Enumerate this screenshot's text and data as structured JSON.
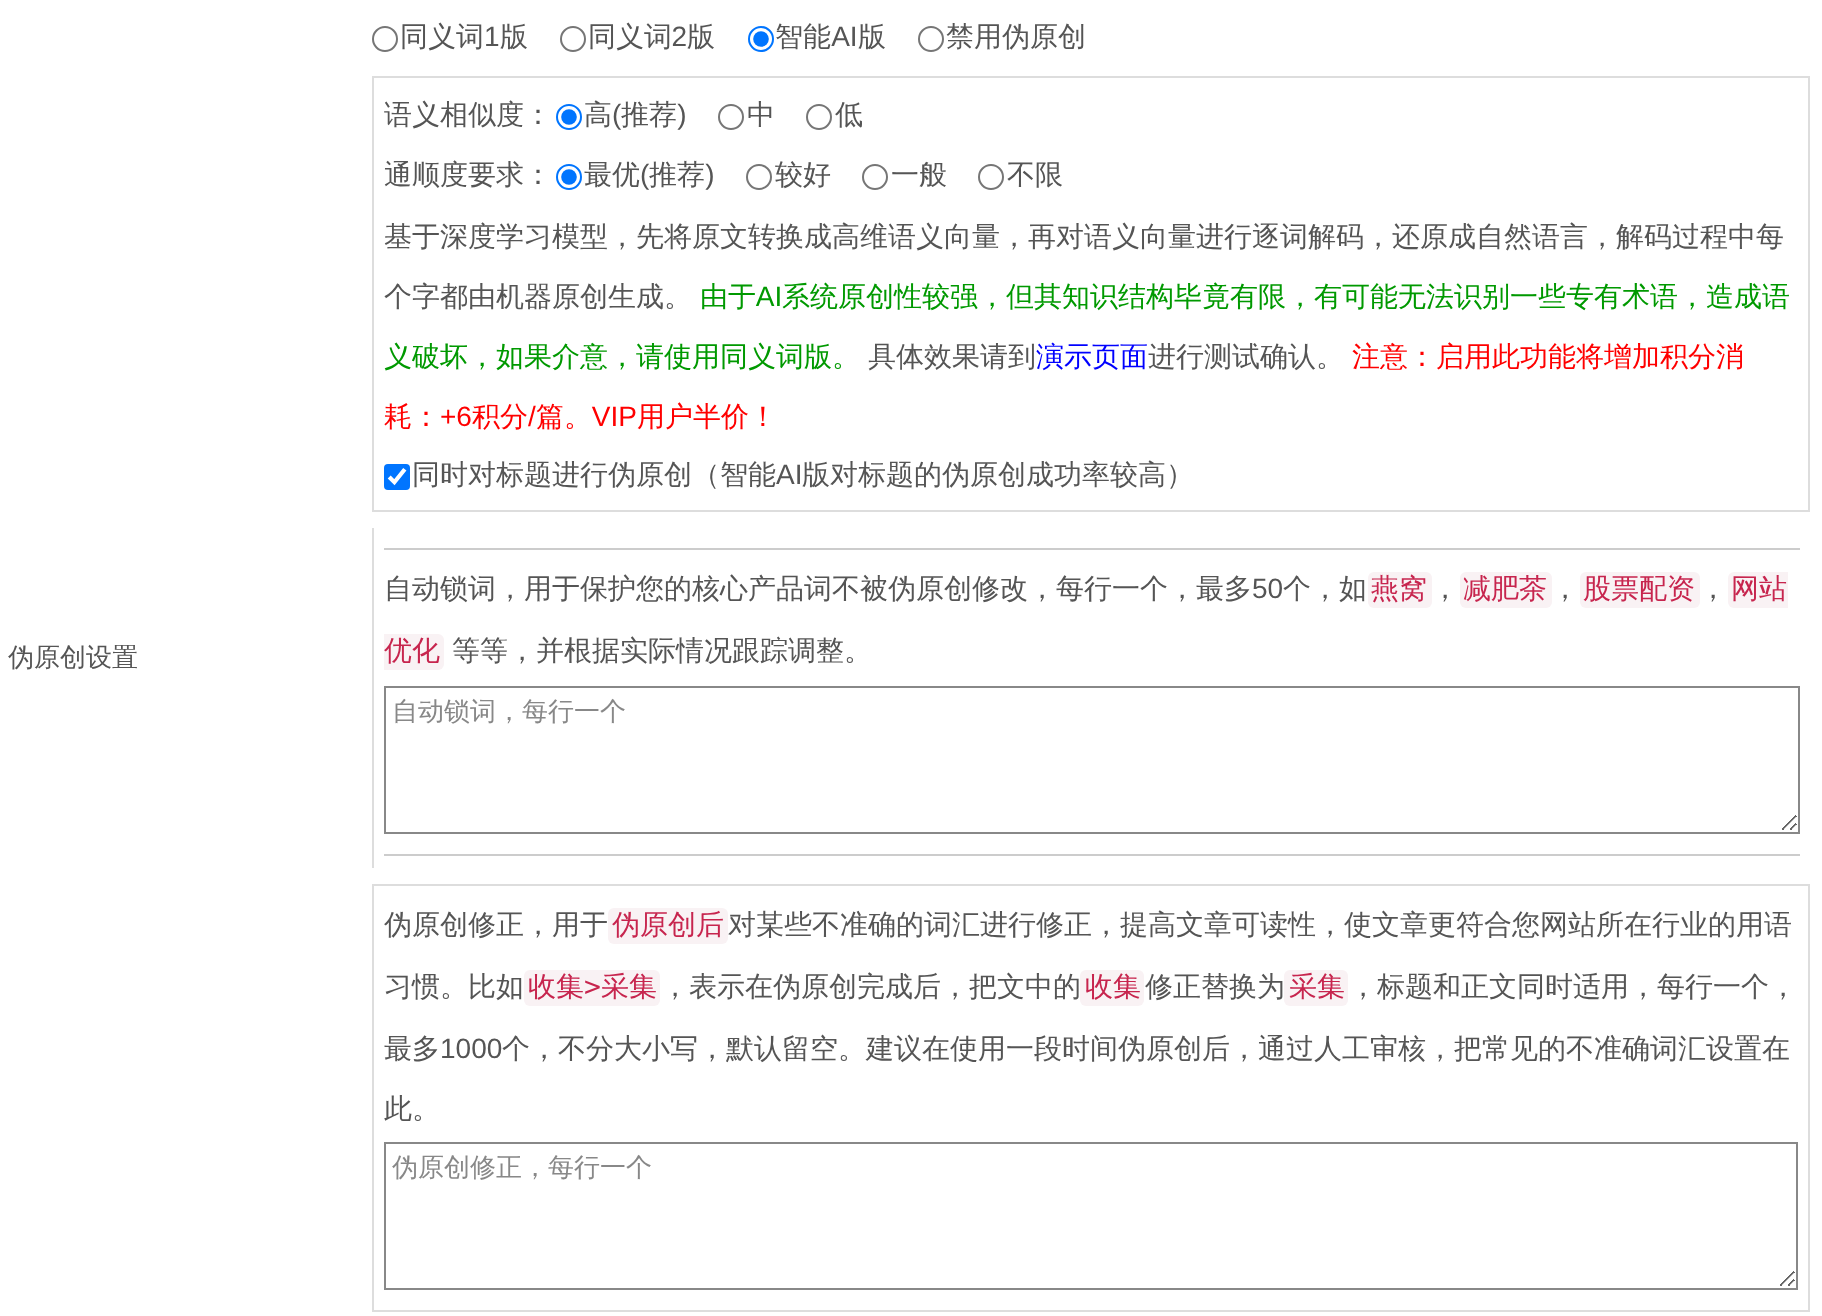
{
  "sidebar_label": "伪原创设置",
  "modes": [
    {
      "label": "同义词1版",
      "selected": false
    },
    {
      "label": "同义词2版",
      "selected": false
    },
    {
      "label": "智能AI版",
      "selected": true
    },
    {
      "label": "禁用伪原创",
      "selected": false
    }
  ],
  "similarity": {
    "label": "语义相似度：",
    "options": [
      {
        "label": "高(推荐)",
        "selected": true
      },
      {
        "label": "中",
        "selected": false
      },
      {
        "label": "低",
        "selected": false
      }
    ]
  },
  "fluency": {
    "label": "通顺度要求：",
    "options": [
      {
        "label": "最优(推荐)",
        "selected": true
      },
      {
        "label": "较好",
        "selected": false
      },
      {
        "label": "一般",
        "selected": false
      },
      {
        "label": "不限",
        "selected": false
      }
    ]
  },
  "ai_description": [
    {
      "kind": "text",
      "text": "基于深度学习模型，先将原文转换成高维语义向量，再对语义向量进行逐词解码，还原成自然语言，解码过程中每个字都由机器原创生成。 "
    },
    {
      "kind": "note",
      "text": "由于AI系统原创性较强，但其知识结构毕竟有限，有可能无法识别一些专有术语，造成语义破坏，如果介意，请使用同义词版。"
    },
    {
      "kind": "text",
      "text": " 具体效果请到"
    },
    {
      "kind": "link",
      "text": "演示页面"
    },
    {
      "kind": "text",
      "text": "进行测试确认。 "
    },
    {
      "kind": "warning",
      "text": "注意：启用此功能将增加积分消耗：+6积分/篇。VIP用户半价！"
    }
  ],
  "title_option": {
    "label": "同时对标题进行伪原创（智能AI版对标题的伪原创成功率较高）",
    "checked": true
  },
  "lock_words": {
    "description": [
      {
        "kind": "text",
        "text": "自动锁词，用于保护您的核心产品词不被伪原创修改，每行一个，最多50个，如"
      },
      {
        "kind": "tag",
        "text": "燕窝"
      },
      {
        "kind": "text",
        "text": "，"
      },
      {
        "kind": "tag",
        "text": "减肥茶"
      },
      {
        "kind": "text",
        "text": "，"
      },
      {
        "kind": "tag",
        "text": "股票配资"
      },
      {
        "kind": "text",
        "text": "，"
      },
      {
        "kind": "tag",
        "text": "网站优化"
      },
      {
        "kind": "text",
        "text": " 等等，并根据实际情况跟踪调整。"
      }
    ],
    "placeholder": "自动锁词，每行一个"
  },
  "corrections": {
    "description": [
      {
        "kind": "text",
        "text": "伪原创修正，用于"
      },
      {
        "kind": "tag",
        "text": "伪原创后"
      },
      {
        "kind": "text",
        "text": "对某些不准确的词汇进行修正，提高文章可读性，使文章更符合您网站所在行业的用语习惯。比如"
      },
      {
        "kind": "tag",
        "text": "收集>采集"
      },
      {
        "kind": "text",
        "text": "，表示在伪原创完成后，把文中的"
      },
      {
        "kind": "tag",
        "text": "收集"
      },
      {
        "kind": "text",
        "text": "修正替换为"
      },
      {
        "kind": "tag",
        "text": "采集"
      },
      {
        "kind": "text",
        "text": "，标题和正文同时适用，每行一个，最多1000个，不分大小写，默认留空。建议在使用一段时间伪原创后，通过人工审核，把常见的不准确词汇设置在此。"
      }
    ],
    "placeholder": "伪原创修正，每行一个"
  }
}
